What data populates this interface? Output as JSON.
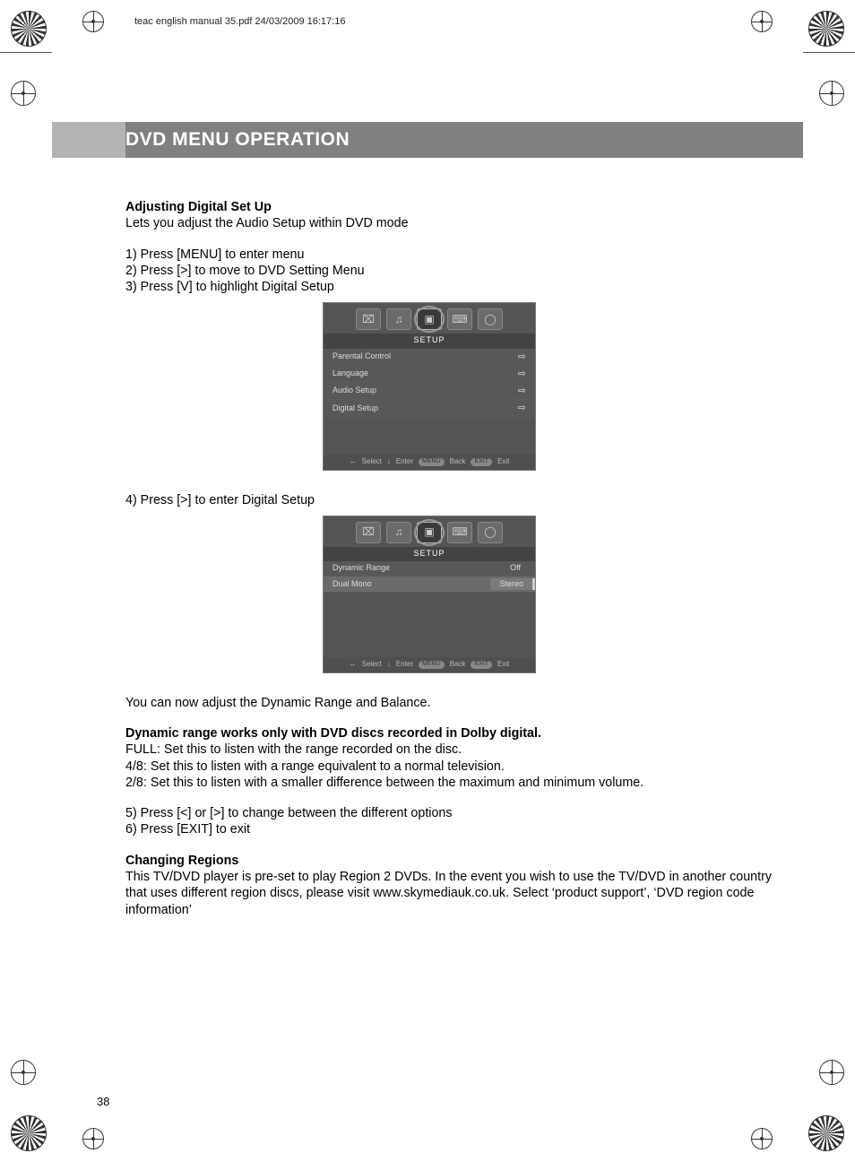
{
  "slug": "teac english manual 35.pdf   24/03/2009   16:17:16",
  "section_title": "DVD MENU OPERATION",
  "h_adjusting": "Adjusting Digital Set Up",
  "p_intro": "Lets you adjust the Audio Setup within DVD mode",
  "steps_a": [
    "1) Press [MENU] to enter menu",
    "2) Press [>] to move to DVD Setting Menu",
    "3) Press [V] to highlight Digital Setup"
  ],
  "osd1": {
    "title": "SETUP",
    "rows": [
      {
        "label": "Parental Control"
      },
      {
        "label": "Language"
      },
      {
        "label": "Audio Setup"
      },
      {
        "label": "Digital Setup"
      }
    ],
    "hint": {
      "select": "Select",
      "enter": "Enter",
      "back_pill": "MENU",
      "back": "Back",
      "exit_pill": "EXIT",
      "exit": "Exit"
    }
  },
  "step4": "4) Press [>] to enter Digital Setup",
  "osd2": {
    "title": "SETUP",
    "rows": [
      {
        "label": "Dynamic Range",
        "value": "Off"
      },
      {
        "label": "Dual Mono",
        "value": "Stereo"
      }
    ],
    "hint": {
      "select": "Select",
      "enter": "Enter",
      "back_pill": "MENU",
      "back": "Back",
      "exit_pill": "EXIT",
      "exit": "Exit"
    }
  },
  "p_after": "You can now adjust the Dynamic Range and Balance.",
  "h_dynamic": "Dynamic range works only with DVD discs recorded in Dolby digital.",
  "p_full": "FULL: Set this to listen with the range recorded on the disc.",
  "p_48": "4/8: Set this to listen with a range equivalent to a normal television.",
  "p_28": "2/8: Set this to listen with a smaller difference between the maximum and minimum volume.",
  "step5": "5) Press [<] or [>] to change between the different options",
  "step6": "6) Press [EXIT] to exit",
  "h_regions": "Changing Regions",
  "p_regions": "This TV/DVD player is pre-set to play Region 2 DVDs. In the event you wish to use the TV/DVD in another country that uses different region discs, please visit www.skymediauk.co.uk. Select ‘product support’, ‘DVD region code information’",
  "page_number": "38",
  "icons": {
    "tab1": "⌧",
    "tab2": "♫",
    "tab3": "▣",
    "tab4": "⌨",
    "tab5": "◯",
    "lr": "↔",
    "down": "↓",
    "right_arrow": "⇨"
  }
}
